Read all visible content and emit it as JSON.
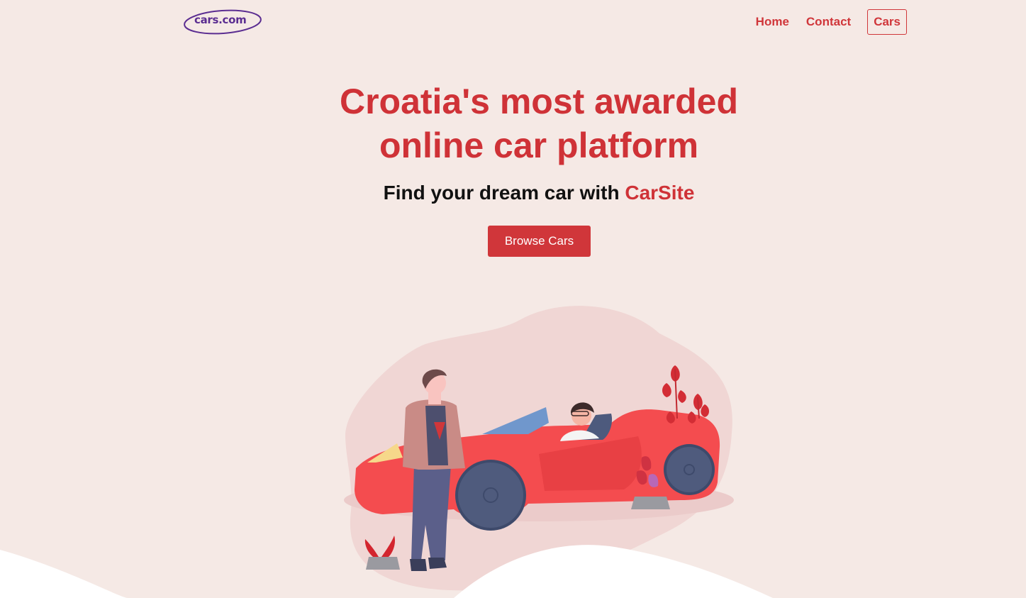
{
  "header": {
    "logo_text": "cars.com",
    "logo_mark": "™",
    "nav": [
      {
        "label": "Home",
        "active": false
      },
      {
        "label": "Contact",
        "active": false
      },
      {
        "label": "Cars",
        "active": true
      }
    ]
  },
  "hero": {
    "title_line1": "Croatia's most awarded",
    "title_line2": "online car platform",
    "subtitle_prefix": "Find your dream car with ",
    "subtitle_brand": "CarSite",
    "cta_label": "Browse Cars"
  },
  "colors": {
    "background": "#f5e9e5",
    "accent": "#d0363a",
    "logo": "#5b2d91"
  },
  "illustration": {
    "icon": "car-with-people-illustration"
  }
}
